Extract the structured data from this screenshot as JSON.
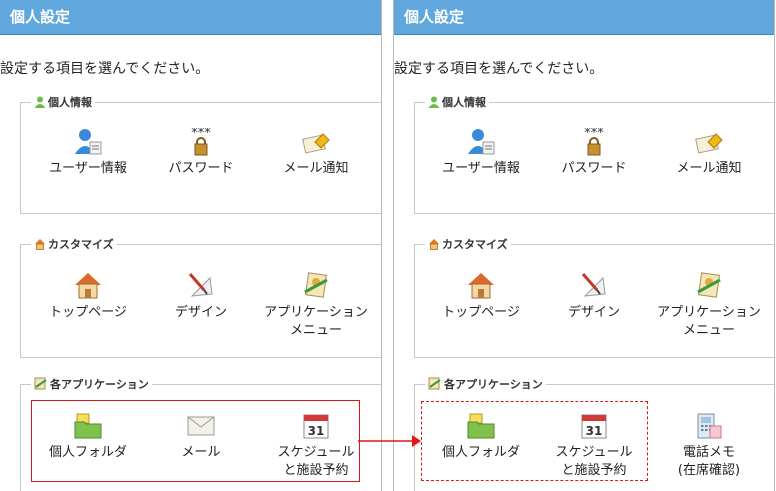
{
  "panels": [
    {
      "title": "個人設定",
      "intro": "設定する項目を選んでください。",
      "sections": [
        {
          "title": "個人情報",
          "items": [
            {
              "label": "ユーザー情報",
              "label2": "",
              "icon": "user-info-icon"
            },
            {
              "label": "パスワード",
              "label2": "",
              "icon": "password-icon"
            },
            {
              "label": "メール通知",
              "label2": "",
              "icon": "mail-notify-icon"
            }
          ]
        },
        {
          "title": "カスタマイズ",
          "items": [
            {
              "label": "トップページ",
              "label2": "",
              "icon": "home-icon"
            },
            {
              "label": "デザイン",
              "label2": "",
              "icon": "design-icon"
            },
            {
              "label": "アプリケーション",
              "label2": "メニュー",
              "icon": "app-menu-icon"
            }
          ]
        },
        {
          "title": "各アプリケーション",
          "items": [
            {
              "label": "個人フォルダ",
              "label2": "",
              "icon": "folder-icon"
            },
            {
              "label": "メール",
              "label2": "",
              "icon": "envelope-icon"
            },
            {
              "label": "スケジュール",
              "label2": "と施設予約",
              "icon": "calendar-icon"
            }
          ]
        }
      ]
    },
    {
      "title": "個人設定",
      "intro": "設定する項目を選んでください。",
      "sections": [
        {
          "title": "個人情報",
          "items": [
            {
              "label": "ユーザー情報",
              "label2": "",
              "icon": "user-info-icon"
            },
            {
              "label": "パスワード",
              "label2": "",
              "icon": "password-icon"
            },
            {
              "label": "メール通知",
              "label2": "",
              "icon": "mail-notify-icon"
            }
          ]
        },
        {
          "title": "カスタマイズ",
          "items": [
            {
              "label": "トップページ",
              "label2": "",
              "icon": "home-icon"
            },
            {
              "label": "デザイン",
              "label2": "",
              "icon": "design-icon"
            },
            {
              "label": "アプリケーション",
              "label2": "メニュー",
              "icon": "app-menu-icon"
            }
          ]
        },
        {
          "title": "各アプリケーション",
          "items": [
            {
              "label": "個人フォルダ",
              "label2": "",
              "icon": "folder-icon"
            },
            {
              "label": "スケジュール",
              "label2": "と施設予約",
              "icon": "calendar-icon"
            },
            {
              "label": "電話メモ",
              "label2": "(在席確認)",
              "icon": "phone-memo-icon"
            }
          ]
        }
      ]
    }
  ],
  "password_icon_text": "***",
  "calendar_day": "31",
  "colors": {
    "header": "#5fa7dc",
    "highlight": "#e01515"
  }
}
